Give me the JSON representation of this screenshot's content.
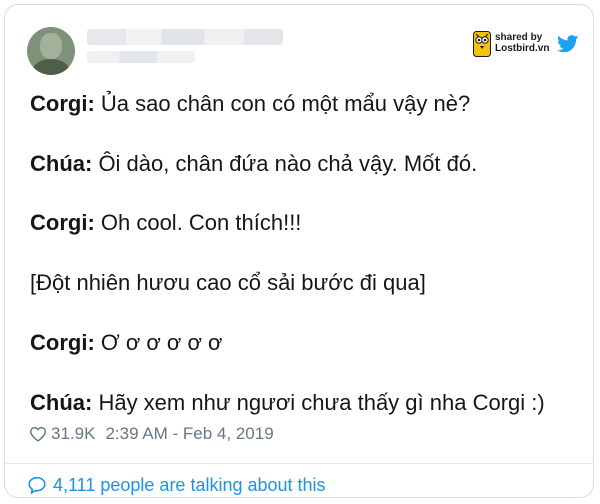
{
  "header": {
    "shared_by_line1": "shared by",
    "shared_by_line2": "Lostbird.vn",
    "avatar_icon": "user-avatar-icon",
    "logo_icon": "lostbird-logo-icon",
    "platform_icon": "twitter-bird-icon",
    "brand_color": "#1da1f2"
  },
  "tweet": {
    "lines": [
      {
        "speaker": "Corgi:",
        "text": " Ủa sao chân con có một mẩu vậy nè?"
      },
      {
        "speaker": "Chúa:",
        "text": " Ôi dào, chân đứa nào chả vậy. Mốt đó."
      },
      {
        "speaker": "Corgi:",
        "text": " Oh cool. Con thích!!!"
      },
      {
        "speaker": "",
        "text": "[Đột nhiên hươu cao cổ sải bước đi qua]"
      },
      {
        "speaker": "Corgi:",
        "text": " Ơ ơ ơ ơ ơ ơ"
      },
      {
        "speaker": "Chúa:",
        "text": " Hãy xem như ngươi chưa thấy gì nha Corgi :)"
      }
    ]
  },
  "meta": {
    "likes": "31.9K",
    "time": "2:39 AM - Feb 4, 2019",
    "heart_icon": "heart-icon"
  },
  "footer": {
    "talking_text": "4,111 people are talking about this",
    "link_color": "#1b95e0",
    "comment_icon": "comment-icon"
  }
}
